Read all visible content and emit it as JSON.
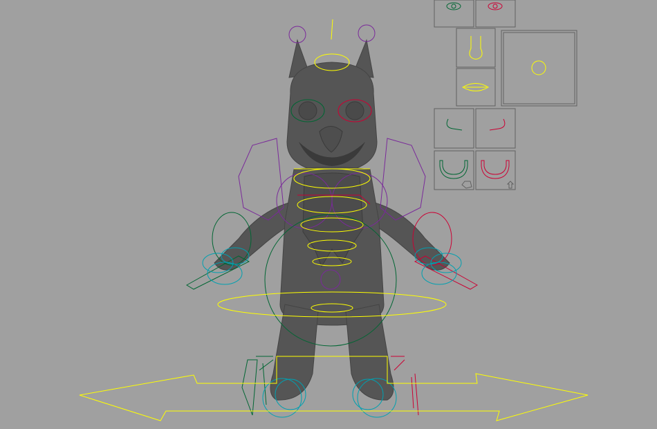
{
  "viewport": {
    "background": "#a0a0a0",
    "mesh_color": "#555555"
  },
  "colors": {
    "center_controls": "#ffff00",
    "left_controls": "#cc0033",
    "right_controls": "#006633",
    "fk_controls": "#7a2a9a",
    "finger_controls": "#00a0b0",
    "face_panel_border": "#606060"
  },
  "face_panel": {
    "cells": [
      "eye-right",
      "eye-left",
      "nose",
      "jaw-slider",
      "mouth",
      "mouth-corner-right",
      "mouth-corner-left",
      "lip-curl-right",
      "lip-curl-left"
    ]
  }
}
